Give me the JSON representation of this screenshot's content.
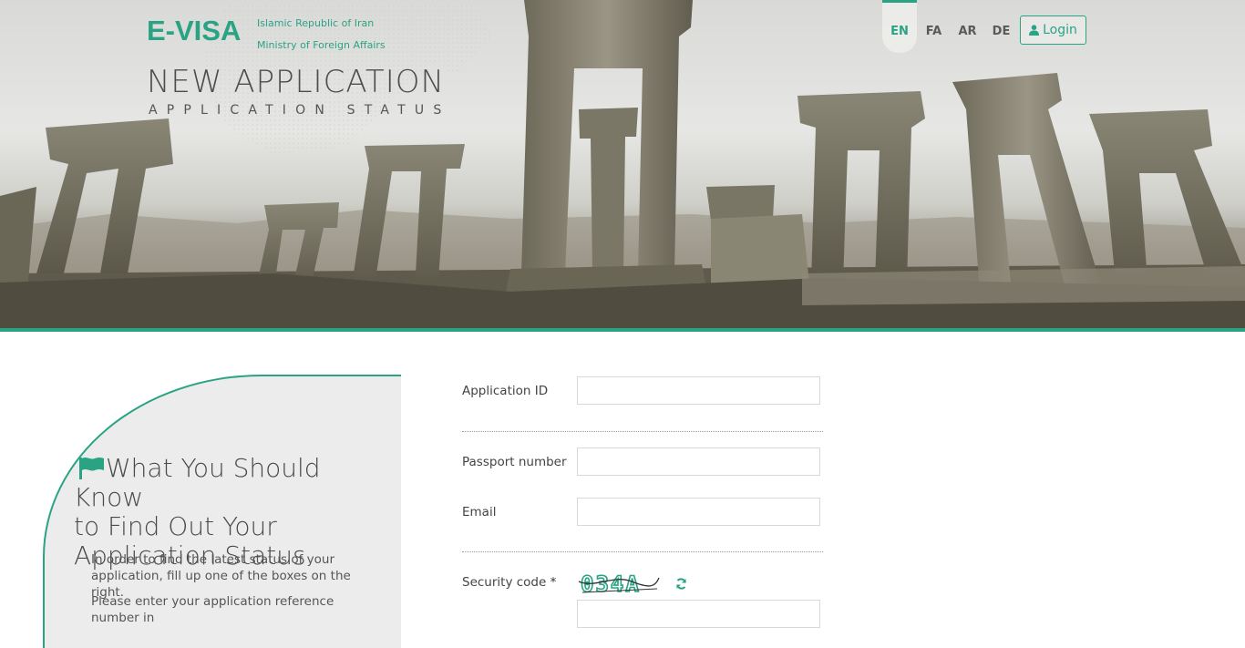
{
  "header": {
    "brand": "E-VISA",
    "brand_sub_1": "Islamic Republic of Iran",
    "brand_sub_2": "Ministry of Foreign Affairs",
    "title": "NEW APPLICATION",
    "subtitle": "APPLICATION STATUS",
    "languages": [
      {
        "code": "EN",
        "active": true
      },
      {
        "code": "FA",
        "active": false
      },
      {
        "code": "AR",
        "active": false
      },
      {
        "code": "DE",
        "active": false
      }
    ],
    "login_label": "Login",
    "login_icon": "user-icon"
  },
  "info": {
    "icon": "flag-icon",
    "title_line1": "What You Should Know",
    "title_line2": "to Find Out Your",
    "title_line3": "Application Status",
    "paragraph1": "In order to find the latest status of your application, fill up one of the boxes on the right.",
    "paragraph2": "Please enter your application reference number in"
  },
  "form": {
    "application_id_label": "Application ID",
    "application_id_value": "",
    "passport_label": "Passport number",
    "passport_value": "",
    "email_label": "Email",
    "email_value": "",
    "security_code_label": "Security code",
    "security_code_required": "*",
    "captcha_text": "034A",
    "refresh_icon": "refresh-icon"
  },
  "colors": {
    "accent": "#2aa385",
    "panel_bg": "#ececec",
    "text": "#4a4a4a"
  }
}
